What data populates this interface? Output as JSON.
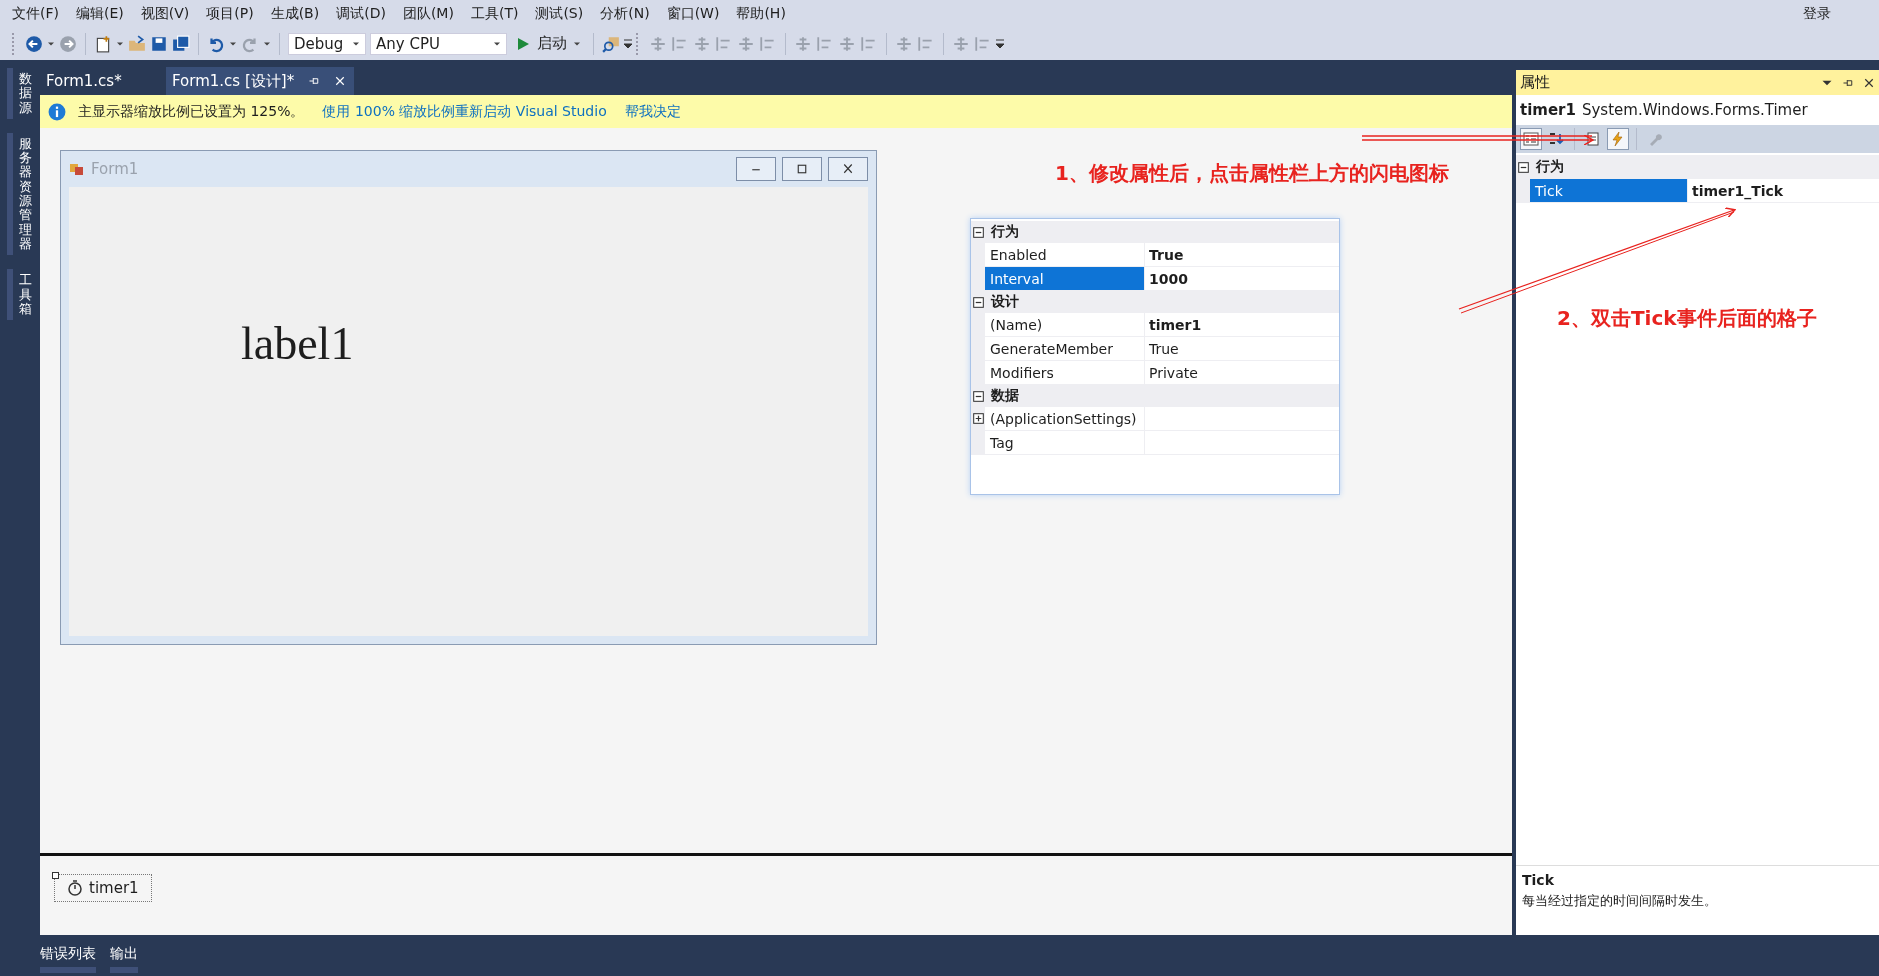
{
  "menu": [
    "文件(F)",
    "编辑(E)",
    "视图(V)",
    "项目(P)",
    "生成(B)",
    "调试(D)",
    "团队(M)",
    "工具(T)",
    "测试(S)",
    "分析(N)",
    "窗口(W)",
    "帮助(H)"
  ],
  "login": "登录",
  "toolbar": {
    "configuration": "Debug",
    "platform": "Any CPU",
    "start_label": "启动"
  },
  "side_tabs": [
    "数据源",
    "服务器资源管理器",
    "工具箱"
  ],
  "document_tabs": [
    {
      "label": "Form1.cs*",
      "selected": false
    },
    {
      "label": "Form1.cs [设计]*",
      "selected": true
    }
  ],
  "info_bar": {
    "message": "主显示器缩放比例已设置为 125%。",
    "links": [
      "使用 100% 缩放比例重新启动 Visual Studio",
      "帮我决定"
    ]
  },
  "form": {
    "title": "Form1",
    "label": "label1"
  },
  "property_grid": {
    "categories": [
      {
        "name": "行为",
        "expanded": true,
        "rows": [
          {
            "name": "Enabled",
            "value": "True",
            "bold": true,
            "selected": false
          },
          {
            "name": "Interval",
            "value": "1000",
            "bold": true,
            "selected": true
          }
        ]
      },
      {
        "name": "设计",
        "expanded": true,
        "rows": [
          {
            "name": "(Name)",
            "value": "timer1",
            "bold": true,
            "selected": false
          },
          {
            "name": "GenerateMember",
            "value": "True",
            "bold": false,
            "selected": false
          },
          {
            "name": "Modifiers",
            "value": "Private",
            "bold": false,
            "selected": false
          }
        ]
      },
      {
        "name": "数据",
        "expanded": true,
        "rows": [
          {
            "name": "(ApplicationSettings)",
            "expandable": true,
            "bold": false,
            "selected": false
          },
          {
            "name": "Tag",
            "bold": false,
            "selected": false
          }
        ]
      }
    ]
  },
  "annotations": [
    "1、修改属性后，点击属性栏上方的闪电图标",
    "2、双击Tick事件后面的格子"
  ],
  "tray": {
    "components": [
      "timer1"
    ]
  },
  "properties_panel": {
    "title": "属性",
    "object_name": "timer1",
    "object_type": "System.Windows.Forms.Timer",
    "toolbar_buttons": [
      {
        "kind": "categorized",
        "selected": true
      },
      {
        "kind": "alphabetical",
        "selected": false
      },
      {
        "kind": "properties",
        "selected": false
      },
      {
        "kind": "events",
        "selected": true
      },
      {
        "kind": "property-pages",
        "selected": false
      }
    ],
    "categories": [
      {
        "name": "行为",
        "expanded": true,
        "rows": [
          {
            "name": "Tick",
            "value": "timer1_Tick",
            "bold": true,
            "selected": true
          }
        ]
      }
    ],
    "description": {
      "title": "Tick",
      "text": "每当经过指定的时间间隔时发生。"
    }
  },
  "bottom_tabs": [
    "错误列表",
    "输出"
  ]
}
